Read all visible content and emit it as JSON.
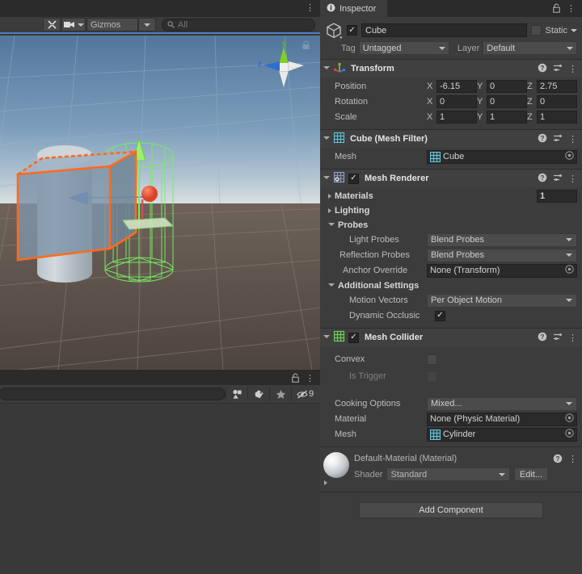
{
  "scene_view": {
    "tab_kebab": "⋮",
    "toolbar": {
      "tools_icon": "wrench-icon",
      "camera_label": "camera-icon",
      "gizmos_label": "Gizmos",
      "search_placeholder": "All",
      "search_value": ""
    },
    "gizmo": {
      "y_label": "y",
      "z_label": "z"
    },
    "selected_outline_color": "#ff6a1e",
    "collider_wire_color": "#8cff6a",
    "sky_top_color": "#5b7fa4",
    "ground_color": "#5f544d"
  },
  "project_panel": {
    "lock_icon": "lock-icon",
    "kebab_icon": "⋮",
    "search_value": "",
    "filter_buttons": [
      "asset-type-filter",
      "label-filter",
      "favorite-filter"
    ],
    "hidden_count": "9"
  },
  "inspector": {
    "tab_label": "Inspector",
    "tab_icon": "info-icon",
    "lock_icon": "lock-icon",
    "kebab_icon": "⋮",
    "gameobject": {
      "enabled": true,
      "name": "Cube",
      "static_label": "Static",
      "static_checked": false,
      "tag_label": "Tag",
      "tag_value": "Untagged",
      "layer_label": "Layer",
      "layer_value": "Default"
    },
    "components": [
      {
        "title": "Transform",
        "icon": "transform-axis-icon",
        "rows": [
          {
            "label": "Position",
            "x": "-6.15",
            "y": "0",
            "z": "2.75"
          },
          {
            "label": "Rotation",
            "x": "0",
            "y": "0",
            "z": "0"
          },
          {
            "label": "Scale",
            "x": "1",
            "y": "1",
            "z": "1"
          }
        ],
        "axis_keys": [
          "X",
          "Y",
          "Z"
        ]
      },
      {
        "title": "Cube (Mesh Filter)",
        "icon": "mesh-filter-icon",
        "mesh_label": "Mesh",
        "mesh_value": "Cube"
      },
      {
        "title": "Mesh Renderer",
        "icon": "mesh-renderer-icon",
        "enabled": true,
        "materials_label": "Materials",
        "materials_count": "1",
        "lighting_label": "Lighting",
        "probes_label": "Probes",
        "light_probes_label": "Light Probes",
        "light_probes_value": "Blend Probes",
        "reflection_probes_label": "Reflection Probes",
        "reflection_probes_value": "Blend Probes",
        "anchor_override_label": "Anchor Override",
        "anchor_override_value": "None (Transform)",
        "additional_settings_label": "Additional Settings",
        "motion_vectors_label": "Motion Vectors",
        "motion_vectors_value": "Per Object Motion",
        "dynamic_occlusion_label": "Dynamic Occlusic",
        "dynamic_occlusion_checked": true
      },
      {
        "title": "Mesh Collider",
        "icon": "mesh-collider-icon",
        "enabled": true,
        "convex_label": "Convex",
        "convex_checked": false,
        "is_trigger_label": "Is Trigger",
        "is_trigger_checked": false,
        "cooking_options_label": "Cooking Options",
        "cooking_options_value": "Mixed...",
        "material_label": "Material",
        "material_value": "None (Physic Material)",
        "mesh_label": "Mesh",
        "mesh_value": "Cylinder"
      }
    ],
    "material_preview": {
      "title": "Default-Material (Material)",
      "shader_label": "Shader",
      "shader_value": "Standard",
      "edit_label": "Edit..."
    },
    "add_component_label": "Add Component"
  }
}
